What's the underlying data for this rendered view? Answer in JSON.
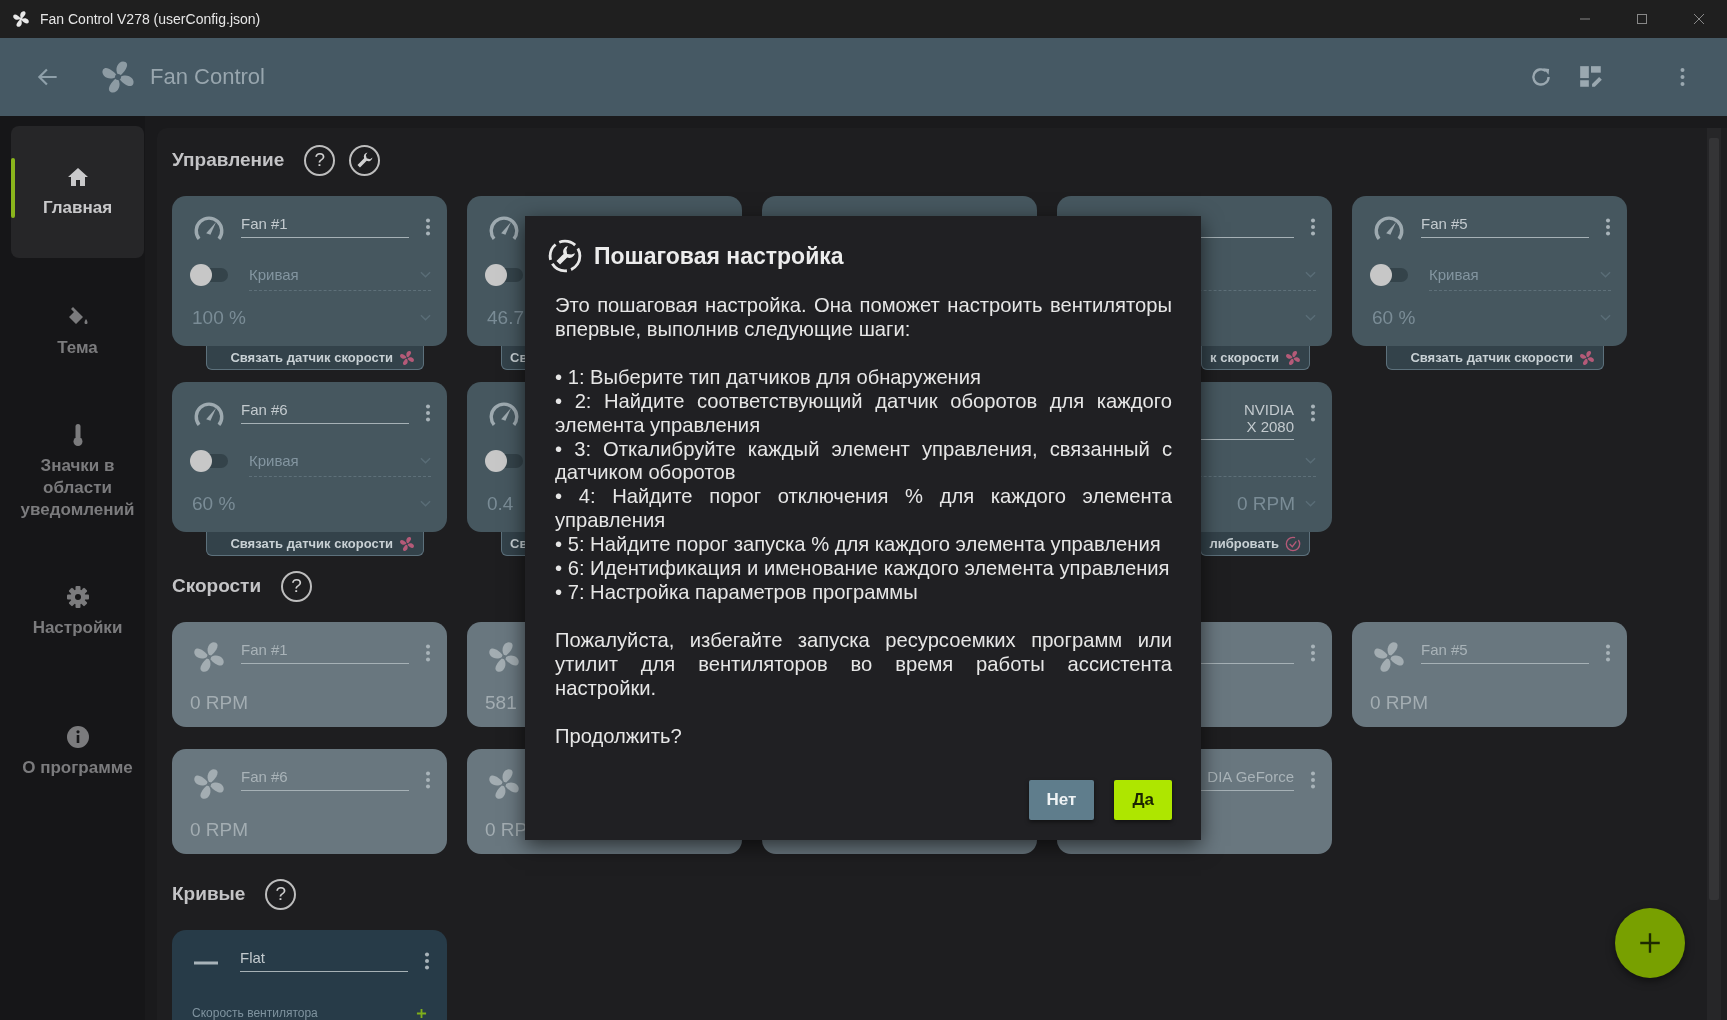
{
  "window": {
    "title": "Fan Control V278 (userConfig.json)"
  },
  "app_bar": {
    "title": "Fan Control"
  },
  "sidebar": {
    "items": [
      {
        "label": "Главная",
        "selected": true
      },
      {
        "label": "Тема",
        "selected": false
      },
      {
        "label": "Значки в области уведомлений",
        "selected": false
      },
      {
        "label": "Настройки",
        "selected": false
      },
      {
        "label": "О программе",
        "selected": false
      }
    ]
  },
  "sections": [
    {
      "title": "Управление",
      "help": "?",
      "wizard_button": true,
      "rows": [
        [
          {
            "kind": "control",
            "name": "Fan #1",
            "toggle_on": false,
            "placeholder": "Кривая",
            "value": "100 %",
            "link": {
              "label": "Связать датчик скорости",
              "kind": "sensor"
            }
          },
          {
            "kind": "control-left",
            "toggle_on": false,
            "value": "46.7",
            "link": {
              "label": "Св",
              "kind": "sensor"
            }
          },
          {
            "kind": "control-top"
          },
          {
            "kind": "control-right",
            "link": {
              "label": "к скорости",
              "kind": "sensor"
            }
          },
          {
            "kind": "control",
            "name": "Fan #5",
            "toggle_on": false,
            "placeholder": "Кривая",
            "value": "60 %",
            "link": {
              "label": "Связать датчик скорости",
              "kind": "sensor"
            }
          }
        ],
        [
          {
            "kind": "control",
            "name": "Fan #6",
            "toggle_on": false,
            "placeholder": "Кривая",
            "value": "60 %",
            "link": {
              "label": "Связать датчик скорости",
              "kind": "sensor"
            }
          },
          {
            "kind": "control-left",
            "toggle_on": false,
            "value": "0.4",
            "link": {
              "label": "Св",
              "kind": "sensor"
            }
          },
          {
            "kind": "covered"
          },
          {
            "kind": "control-right",
            "name": "NVIDIA\nX 2080",
            "value": "0 RPM",
            "link": {
              "label": "либровать",
              "kind": "calibrate"
            }
          }
        ]
      ]
    },
    {
      "title": "Скорости",
      "help": "?",
      "wizard_button": false,
      "rows": [
        [
          {
            "kind": "speed",
            "name": "Fan #1",
            "value": "0 RPM"
          },
          {
            "kind": "speed-left",
            "value": "581"
          },
          {
            "kind": "covered"
          },
          {
            "kind": "speed-right"
          },
          {
            "kind": "speed",
            "name": "Fan #5",
            "value": "0 RPM"
          }
        ],
        [
          {
            "kind": "speed",
            "name": "Fan #6",
            "value": "0 RPM"
          },
          {
            "kind": "speed-left",
            "value": "0 RP"
          },
          {
            "kind": "speed-bottom"
          },
          {
            "kind": "speed-right",
            "name": "DIA GeForce"
          }
        ]
      ]
    },
    {
      "title": "Кривые",
      "help": "?",
      "wizard_button": false,
      "rows": [
        [
          {
            "kind": "curve",
            "name": "Flat",
            "subtitle": "Скорость вентилятора"
          }
        ]
      ]
    }
  ],
  "dialog": {
    "title": "Пошаговая настройка",
    "intro": "Это пошаговая настройка. Она поможет настроить вентиляторы впервые, выполнив следующие шаги:",
    "steps": [
      "• 1: Выберите тип датчиков для обнаружения",
      "• 2: Найдите соответствующий датчик оборотов для каждого элемента управления",
      "• 3: Откалибруйте каждый элемент управления, связанный с датчиком оборотов",
      "• 4: Найдите порог отключения % для каждого элемента управления",
      "• 5: Найдите порог запуска % для каждого элемента управления",
      "• 6: Идентификация и именование каждого элемента управления",
      "• 7: Настройка параметров программы"
    ],
    "note": "Пожалуйста, избегайте запуска ресурсоемких программ или утилит для вентиляторов во время работы ассистента настройки.",
    "question": "Продолжить?",
    "buttons": [
      {
        "label": "Нет",
        "kind": "secondary"
      },
      {
        "label": "Да",
        "kind": "primary"
      }
    ]
  }
}
